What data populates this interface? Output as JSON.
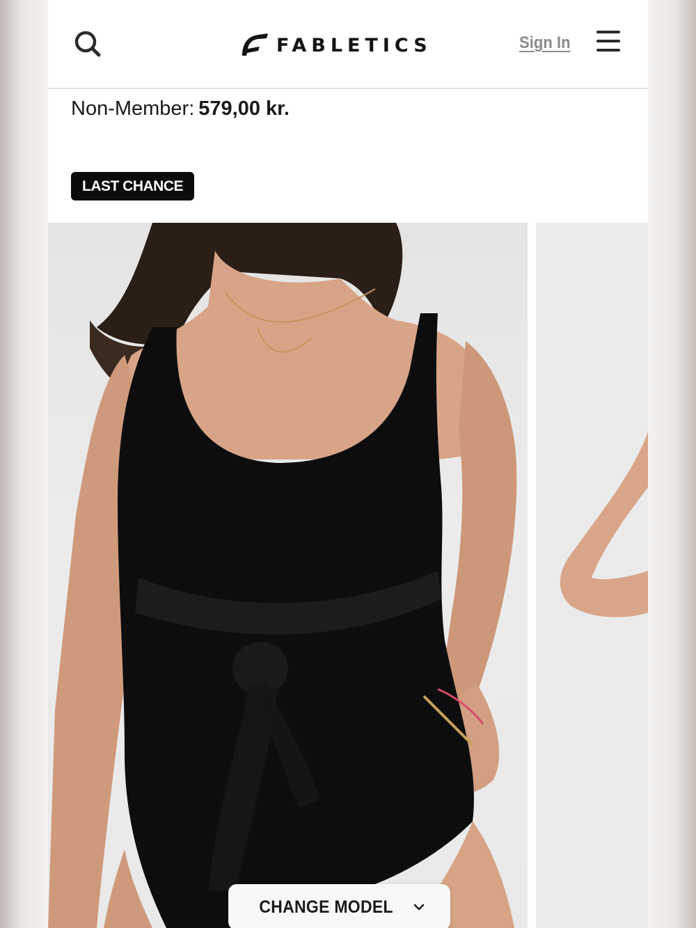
{
  "header": {
    "brand": "FABLETICS",
    "sign_in_label": "Sign In"
  },
  "product": {
    "price_label": "Non-Member:",
    "price_value": "579,00 kr.",
    "badge": "LAST CHANCE"
  },
  "gallery": {
    "change_model_label": "CHANGE MODEL"
  },
  "icons": {
    "search": "search-icon",
    "logo": "fabletics-logo-icon",
    "menu": "hamburger-menu-icon",
    "chevron": "chevron-down-icon"
  },
  "colors": {
    "badge_background": "#0b0b0b",
    "sign_in_text": "#8a8a8a",
    "swimsuit": "#0d0d0d"
  }
}
